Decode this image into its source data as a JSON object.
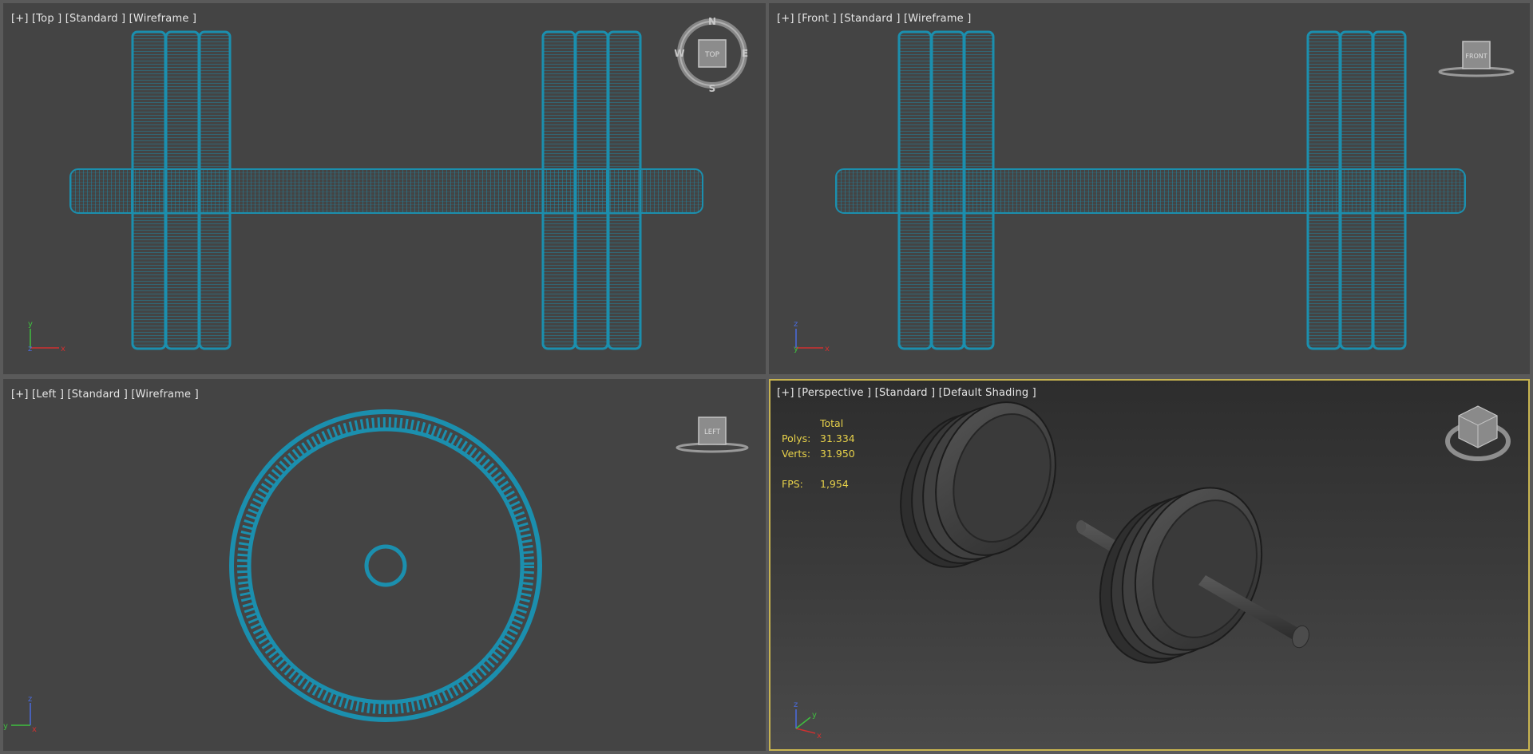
{
  "viewports": {
    "top": {
      "label": "[+] [Top ] [Standard ] [Wireframe ]",
      "cube_label": "TOP",
      "compass": {
        "n": "N",
        "s": "S",
        "e": "E",
        "w": "W"
      },
      "axes": {
        "up": "y",
        "right": "x",
        "origin": "z"
      }
    },
    "front": {
      "label": "[+] [Front ] [Standard ] [Wireframe ]",
      "cube_label": "FRONT",
      "axes": {
        "up": "z",
        "right": "x",
        "origin": "y"
      }
    },
    "left": {
      "label": "[+] [Left ] [Standard ] [Wireframe ]",
      "cube_label": "LEFT",
      "axes": {
        "up": "z",
        "right": "y",
        "origin": "x"
      }
    },
    "perspective": {
      "label": "[+] [Perspective ] [Standard ] [Default Shading ]",
      "axes": {
        "up": "z",
        "right": "x",
        "depth": "y"
      },
      "stats": {
        "header": "Total",
        "polys_label": "Polys:",
        "polys_value": "31.334",
        "verts_label": "Verts:",
        "verts_value": "31.950",
        "fps_label": "FPS:",
        "fps_value": "1,954"
      }
    }
  },
  "colors": {
    "wireframe": "#1b8fae",
    "viewport_bg": "#444444",
    "active_border": "#c8b450",
    "stats_text": "#e8d24a"
  }
}
